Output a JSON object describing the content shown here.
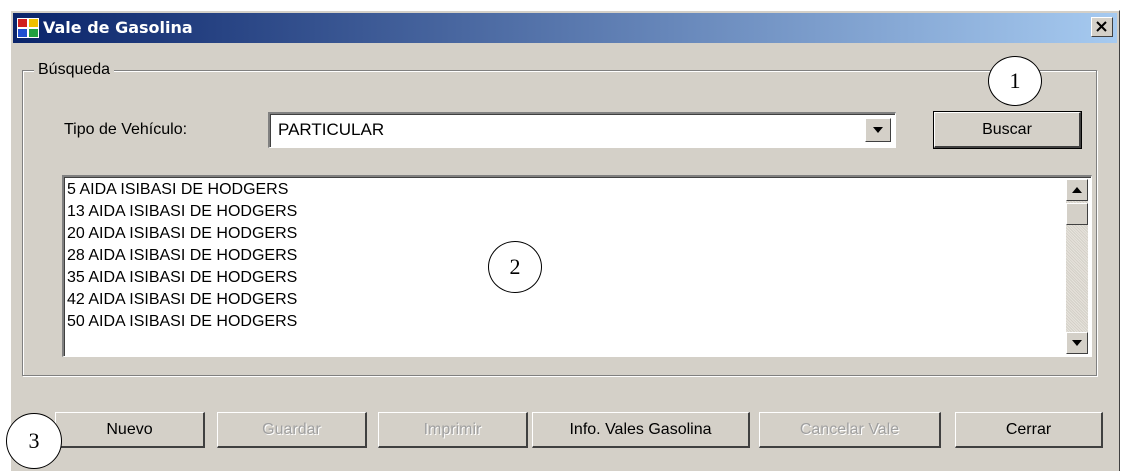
{
  "window": {
    "title": "Vale de Gasolina",
    "close_glyph": "✕"
  },
  "search": {
    "group_label": "Búsqueda",
    "vehicle_type_label": "Tipo de Vehículo:",
    "vehicle_type_value": "PARTICULAR",
    "search_button": "Buscar"
  },
  "results": {
    "items": [
      "5  AIDA ISIBASI DE HODGERS",
      "13 AIDA ISIBASI DE HODGERS",
      "20 AIDA ISIBASI DE HODGERS",
      "28 AIDA ISIBASI DE HODGERS",
      "35 AIDA ISIBASI DE HODGERS",
      "42 AIDA ISIBASI DE HODGERS",
      "50 AIDA ISIBASI DE HODGERS"
    ]
  },
  "actions": {
    "nuevo": "Nuevo",
    "guardar": "Guardar",
    "imprimir": "Imprimir",
    "info_vales": "Info. Vales Gasolina",
    "cancelar_vale": "Cancelar Vale",
    "cerrar": "Cerrar"
  },
  "callouts": [
    "1",
    "2",
    "3"
  ],
  "colors": {
    "title_gradient_start": "#0a246a",
    "title_gradient_end": "#a6caf0",
    "face": "#d4d0c8",
    "disabled_text": "#a0a0a0"
  },
  "icons": {
    "app": "app-window-icon",
    "close": "close-icon",
    "combo": "chevron-down-icon",
    "scroll_up": "scroll-up-arrow-icon",
    "scroll_down": "scroll-down-arrow-icon"
  }
}
